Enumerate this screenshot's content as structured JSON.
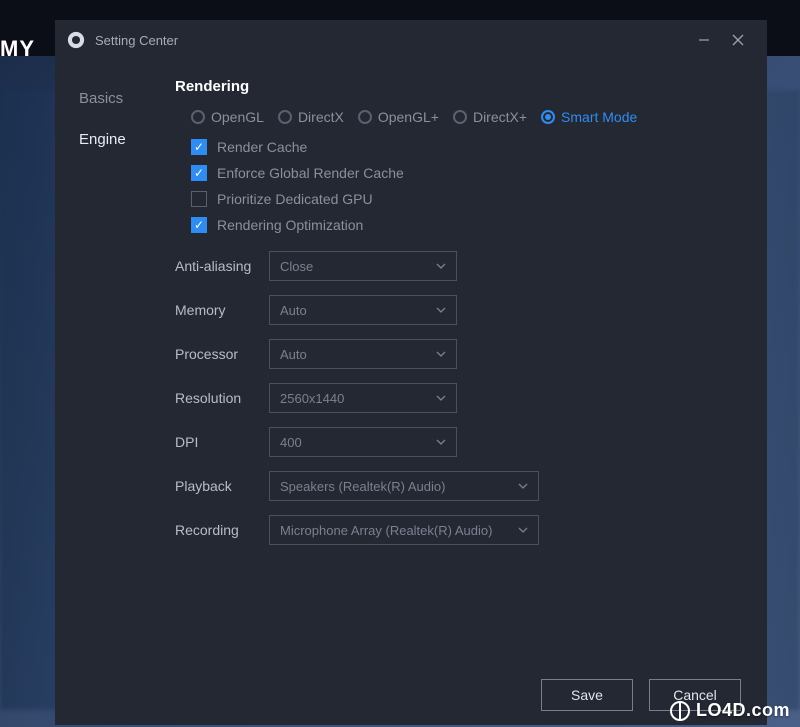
{
  "background": {
    "my_label": "MY"
  },
  "window": {
    "title": "Setting Center"
  },
  "sidebar": {
    "items": [
      {
        "label": "Basics"
      },
      {
        "label": "Engine"
      }
    ],
    "active_index": 1
  },
  "section": {
    "title": "Rendering",
    "radios": [
      {
        "label": "OpenGL",
        "checked": false
      },
      {
        "label": "DirectX",
        "checked": false
      },
      {
        "label": "OpenGL+",
        "checked": false
      },
      {
        "label": "DirectX+",
        "checked": false
      },
      {
        "label": "Smart Mode",
        "checked": true
      }
    ],
    "checks": [
      {
        "label": "Render Cache",
        "checked": true
      },
      {
        "label": "Enforce Global Render Cache",
        "checked": true
      },
      {
        "label": "Prioritize Dedicated GPU",
        "checked": false
      },
      {
        "label": "Rendering Optimization",
        "checked": true
      }
    ]
  },
  "form": {
    "rows": [
      {
        "label": "Anti-aliasing",
        "value": "Close",
        "width": "short"
      },
      {
        "label": "Memory",
        "value": "Auto",
        "width": "short"
      },
      {
        "label": "Processor",
        "value": "Auto",
        "width": "short"
      },
      {
        "label": "Resolution",
        "value": "2560x1440",
        "width": "short"
      },
      {
        "label": "DPI",
        "value": "400",
        "width": "short"
      },
      {
        "label": "Playback",
        "value": "Speakers (Realtek(R) Audio)",
        "width": "wide"
      },
      {
        "label": "Recording",
        "value": "Microphone Array (Realtek(R) Audio)",
        "width": "wide"
      }
    ]
  },
  "footer": {
    "save": "Save",
    "cancel": "Cancel"
  },
  "watermark": "LO4D.com"
}
